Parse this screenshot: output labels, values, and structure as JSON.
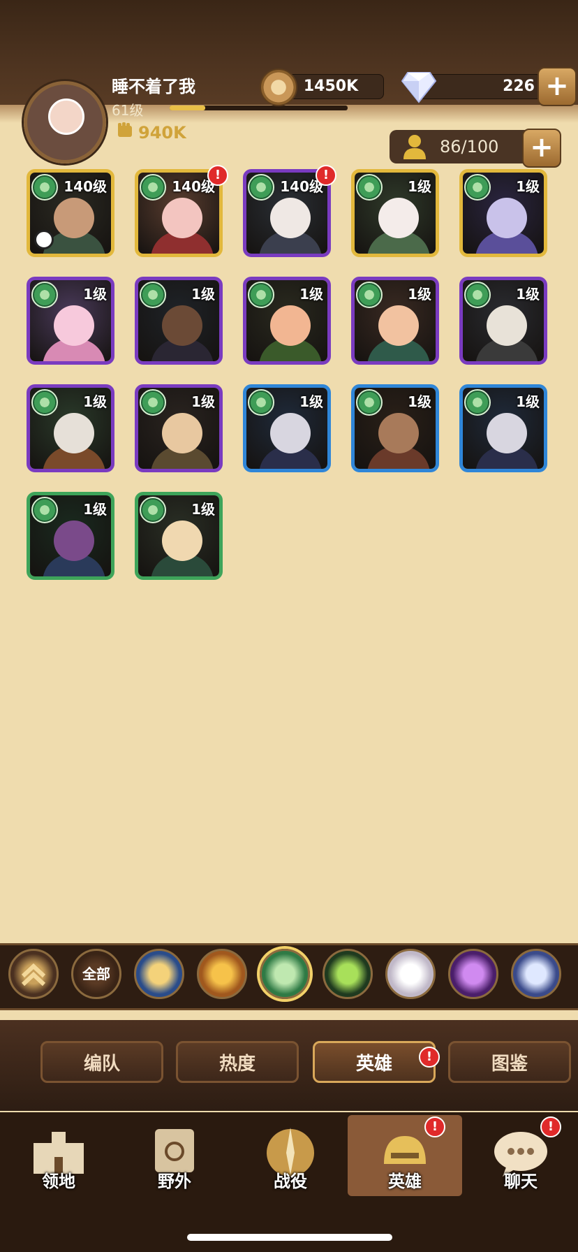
{
  "player": {
    "name": "睡不着了我",
    "level_label": "61级",
    "xp_fraction": 0.2,
    "power": "940K"
  },
  "currency": {
    "gold": "1450K",
    "gems": "226"
  },
  "roster": {
    "count": "86/100"
  },
  "heroes": [
    {
      "level": "140级",
      "rarity": "gold",
      "alert": false,
      "clock": true,
      "skin": "#c89a78",
      "outfit": "#3a5240",
      "bg": "#2b2a22"
    },
    {
      "level": "140级",
      "rarity": "gold",
      "alert": true,
      "clock": false,
      "skin": "#f3c5c0",
      "outfit": "#8f2f2f",
      "bg": "#5a3d2f"
    },
    {
      "level": "140级",
      "rarity": "purple",
      "alert": true,
      "clock": false,
      "skin": "#efe8e4",
      "outfit": "#3b3f4e",
      "bg": "#2a2f35"
    },
    {
      "level": "1级",
      "rarity": "gold",
      "alert": false,
      "clock": false,
      "skin": "#f4ecea",
      "outfit": "#4b6a4a",
      "bg": "#2f3a2a"
    },
    {
      "level": "1级",
      "rarity": "gold",
      "alert": false,
      "clock": false,
      "skin": "#c9c2ea",
      "outfit": "#5a4f9a",
      "bg": "#2a2540"
    },
    {
      "level": "1级",
      "rarity": "purple",
      "alert": false,
      "clock": false,
      "skin": "#f7c9dc",
      "outfit": "#d88ab4",
      "bg": "#4a3a5a"
    },
    {
      "level": "1级",
      "rarity": "purple",
      "alert": false,
      "clock": false,
      "skin": "#6b4a36",
      "outfit": "#2a2633",
      "bg": "#1f2328"
    },
    {
      "level": "1级",
      "rarity": "purple",
      "alert": false,
      "clock": false,
      "skin": "#f2b692",
      "outfit": "#3a5a2a",
      "bg": "#2a2a1f"
    },
    {
      "level": "1级",
      "rarity": "purple",
      "alert": false,
      "clock": false,
      "skin": "#f2c2a0",
      "outfit": "#2f5a4a",
      "bg": "#3a2a22"
    },
    {
      "level": "1级",
      "rarity": "purple",
      "alert": false,
      "clock": false,
      "skin": "#e8e2d8",
      "outfit": "#3a3a3a",
      "bg": "#2a2b30"
    },
    {
      "level": "1级",
      "rarity": "purple",
      "alert": false,
      "clock": false,
      "skin": "#e6e0d8",
      "outfit": "#7a4a2a",
      "bg": "#2a3a2a"
    },
    {
      "level": "1级",
      "rarity": "purple",
      "alert": false,
      "clock": false,
      "skin": "#e8c8a0",
      "outfit": "#5a4a30",
      "bg": "#2a2420"
    },
    {
      "level": "1级",
      "rarity": "blue",
      "alert": false,
      "clock": false,
      "skin": "#d8d6e0",
      "outfit": "#2a2e4a",
      "bg": "#1f2a3a"
    },
    {
      "level": "1级",
      "rarity": "blue",
      "alert": false,
      "clock": false,
      "skin": "#a87a5a",
      "outfit": "#6a3a2a",
      "bg": "#2a2018"
    },
    {
      "level": "1级",
      "rarity": "blue",
      "alert": false,
      "clock": false,
      "skin": "#d8d6e0",
      "outfit": "#2a2e4a",
      "bg": "#1f2a3a"
    },
    {
      "level": "1级",
      "rarity": "green",
      "alert": false,
      "clock": false,
      "skin": "#7a4a8a",
      "outfit": "#2a3a5a",
      "bg": "#1a2a1f"
    },
    {
      "level": "1级",
      "rarity": "green",
      "alert": false,
      "clock": false,
      "skin": "#f0d8b0",
      "outfit": "#2a4a3a",
      "bg": "#2a2f25"
    }
  ],
  "filters": {
    "all_label": "全部",
    "items": [
      {
        "name": "collapse-chevron-icon",
        "c1": "#c9a05a",
        "c2": "#4a3020"
      },
      {
        "name": "all-factions-icon",
        "c1": "#5a3a24",
        "c2": "#3a2416"
      },
      {
        "name": "lightbearer-star-icon",
        "c1": "#f4d27a",
        "c2": "#2a4c8a"
      },
      {
        "name": "mauler-shield-icon",
        "c1": "#f6c24a",
        "c2": "#a0581e"
      },
      {
        "name": "wilder-leaf-icon",
        "c1": "#bfe8b0",
        "c2": "#2f7a45"
      },
      {
        "name": "graveborn-eye-icon",
        "c1": "#a8e05a",
        "c2": "#1f3a1f"
      },
      {
        "name": "celestial-star-icon",
        "c1": "#ffffff",
        "c2": "#c0b8c8"
      },
      {
        "name": "hypogean-crystal-icon",
        "c1": "#d08af0",
        "c2": "#4a1e6a"
      },
      {
        "name": "dimensional-disc-icon",
        "c1": "#dfe8ff",
        "c2": "#3a4a8a"
      }
    ]
  },
  "tabs": [
    {
      "label": "编队",
      "selected": false,
      "alert": false
    },
    {
      "label": "热度",
      "selected": false,
      "alert": false
    },
    {
      "label": "英雄",
      "selected": true,
      "alert": true
    },
    {
      "label": "图鉴",
      "selected": false,
      "alert": false
    }
  ],
  "nav": [
    {
      "label": "领地",
      "icon": "castle-icon",
      "selected": false,
      "alert": false
    },
    {
      "label": "野外",
      "icon": "scroll-map-icon",
      "selected": false,
      "alert": false
    },
    {
      "label": "战役",
      "icon": "crossed-swords-icon",
      "selected": false,
      "alert": false
    },
    {
      "label": "英雄",
      "icon": "hero-helmet-icon",
      "selected": true,
      "alert": true
    },
    {
      "label": "聊天",
      "icon": "chat-bubble-icon",
      "selected": false,
      "alert": true
    }
  ],
  "colors": {
    "gold_frame": "#e2b83c",
    "purple_frame": "#7a3bc0",
    "blue_frame": "#2f86d8",
    "green_frame": "#3ea45a",
    "alert": "#e02a2a"
  }
}
